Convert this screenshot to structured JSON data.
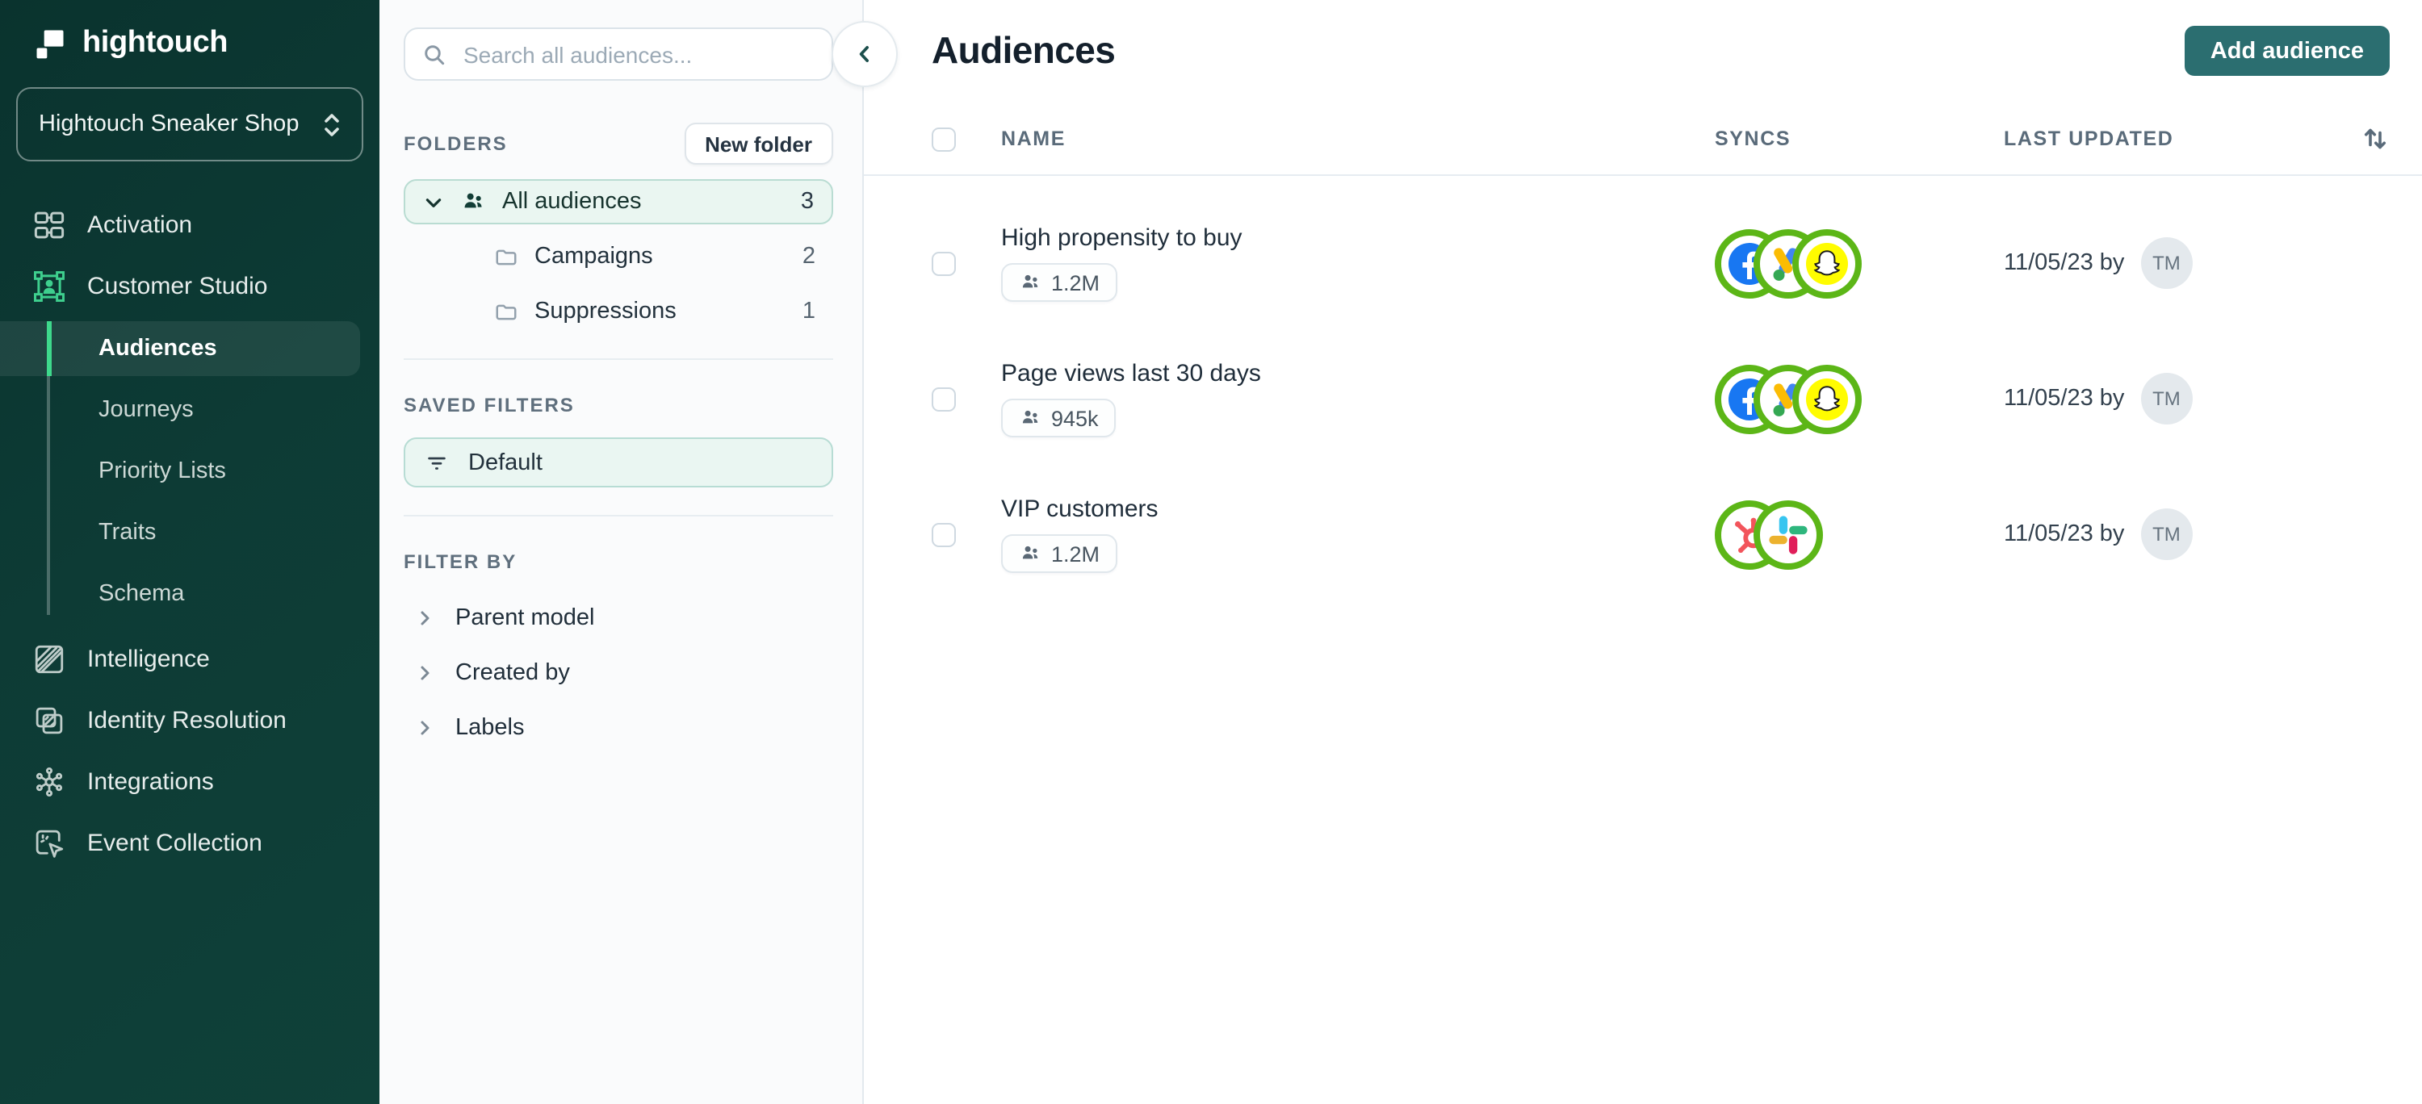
{
  "brand": {
    "logo_text": "hightouch",
    "workspace": "Hightouch Sneaker Shop"
  },
  "sidebar": {
    "nav": [
      {
        "label": "Activation",
        "icon": "activation-icon"
      },
      {
        "label": "Customer Studio",
        "icon": "customer-studio-icon"
      },
      {
        "label": "Intelligence",
        "icon": "intelligence-icon"
      },
      {
        "label": "Identity Resolution",
        "icon": "identity-resolution-icon"
      },
      {
        "label": "Integrations",
        "icon": "integrations-icon"
      },
      {
        "label": "Event Collection",
        "icon": "event-collection-icon"
      }
    ],
    "customer_studio_children": [
      {
        "label": "Audiences",
        "active": true
      },
      {
        "label": "Journeys"
      },
      {
        "label": "Priority Lists"
      },
      {
        "label": "Traits"
      },
      {
        "label": "Schema"
      }
    ]
  },
  "panel": {
    "search_placeholder": "Search all audiences...",
    "collapse_icon": "chevron-left",
    "folders": {
      "header": "FOLDERS",
      "new_folder_label": "New folder",
      "items": [
        {
          "label": "All audiences",
          "count": "3",
          "selected": true,
          "icon": "users-icon"
        },
        {
          "label": "Campaigns",
          "count": "2",
          "icon": "folder-icon"
        },
        {
          "label": "Suppressions",
          "count": "1",
          "icon": "folder-icon"
        }
      ]
    },
    "saved_filters": {
      "header": "SAVED FILTERS",
      "items": [
        {
          "label": "Default",
          "selected": true,
          "icon": "filter-icon"
        }
      ]
    },
    "filter_by": {
      "header": "FILTER BY",
      "items": [
        {
          "label": "Parent model"
        },
        {
          "label": "Created by"
        },
        {
          "label": "Labels"
        }
      ]
    }
  },
  "main": {
    "title": "Audiences",
    "add_button": "Add audience",
    "table": {
      "columns": [
        "NAME",
        "SYNCS",
        "LAST UPDATED"
      ],
      "rows": [
        {
          "name": "High propensity to buy",
          "size": "1.2M",
          "syncs": [
            "facebook",
            "google-ads",
            "snapchat"
          ],
          "updated": "11/05/23 by",
          "avatar": "TM"
        },
        {
          "name": "Page views last 30 days",
          "size": "945k",
          "syncs": [
            "facebook",
            "google-ads",
            "snapchat"
          ],
          "updated": "11/05/23 by",
          "avatar": "TM"
        },
        {
          "name": "VIP customers",
          "size": "1.2M",
          "syncs": [
            "hubspot",
            "slack"
          ],
          "updated": "11/05/23 by",
          "avatar": "TM"
        }
      ]
    }
  },
  "colors": {
    "sidebar_bg": "#0d3b35",
    "accent_green": "#3ecf8e",
    "selected_bar_green": "#3ed98c",
    "button_teal": "#2b6e70",
    "sync_ring_green": "#5cb617",
    "mint_bg": "#eaf6f1",
    "mint_border": "#b9dcd2",
    "facebook_blue": "#1877f2",
    "snapchat_yellow": "#fffc00",
    "hubspot_coral": "#f2545b"
  }
}
